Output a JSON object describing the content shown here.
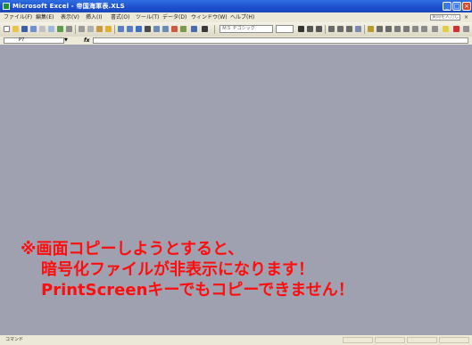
{
  "titlebar": {
    "title": "Microsoft Excel - 帝国海軍表.XLS",
    "minimize": "_",
    "maximize": "□",
    "close": "×"
  },
  "menubar": {
    "items": [
      "ファイル(F)",
      "編集(E)",
      "表示(V)",
      "挿入(I)",
      "書式(O)",
      "ツール(T)",
      "データ(D)",
      "ウィンドウ(W)",
      "ヘルプ(H)"
    ],
    "help_search_placeholder": "質問を入力してください",
    "close_glyph": "×"
  },
  "toolbar": {
    "font_name": "ＭＳ Ｐゴシック",
    "font_size": ""
  },
  "formulabar": {
    "cell_ref": "P7",
    "fx": "fx",
    "formula": ""
  },
  "warning": {
    "line1": "※画面コピーしようとすると、",
    "line2": "暗号化ファイルが非表示になります！",
    "line3": "PrintScreenキーでもコピーできません！"
  },
  "statusbar": {
    "text": "コマンド"
  },
  "colors": {
    "title_bar": "#1d4fcf",
    "workspace": "#9fa0b0",
    "warning_text": "#ff0d0d",
    "chrome": "#ece9d8"
  }
}
